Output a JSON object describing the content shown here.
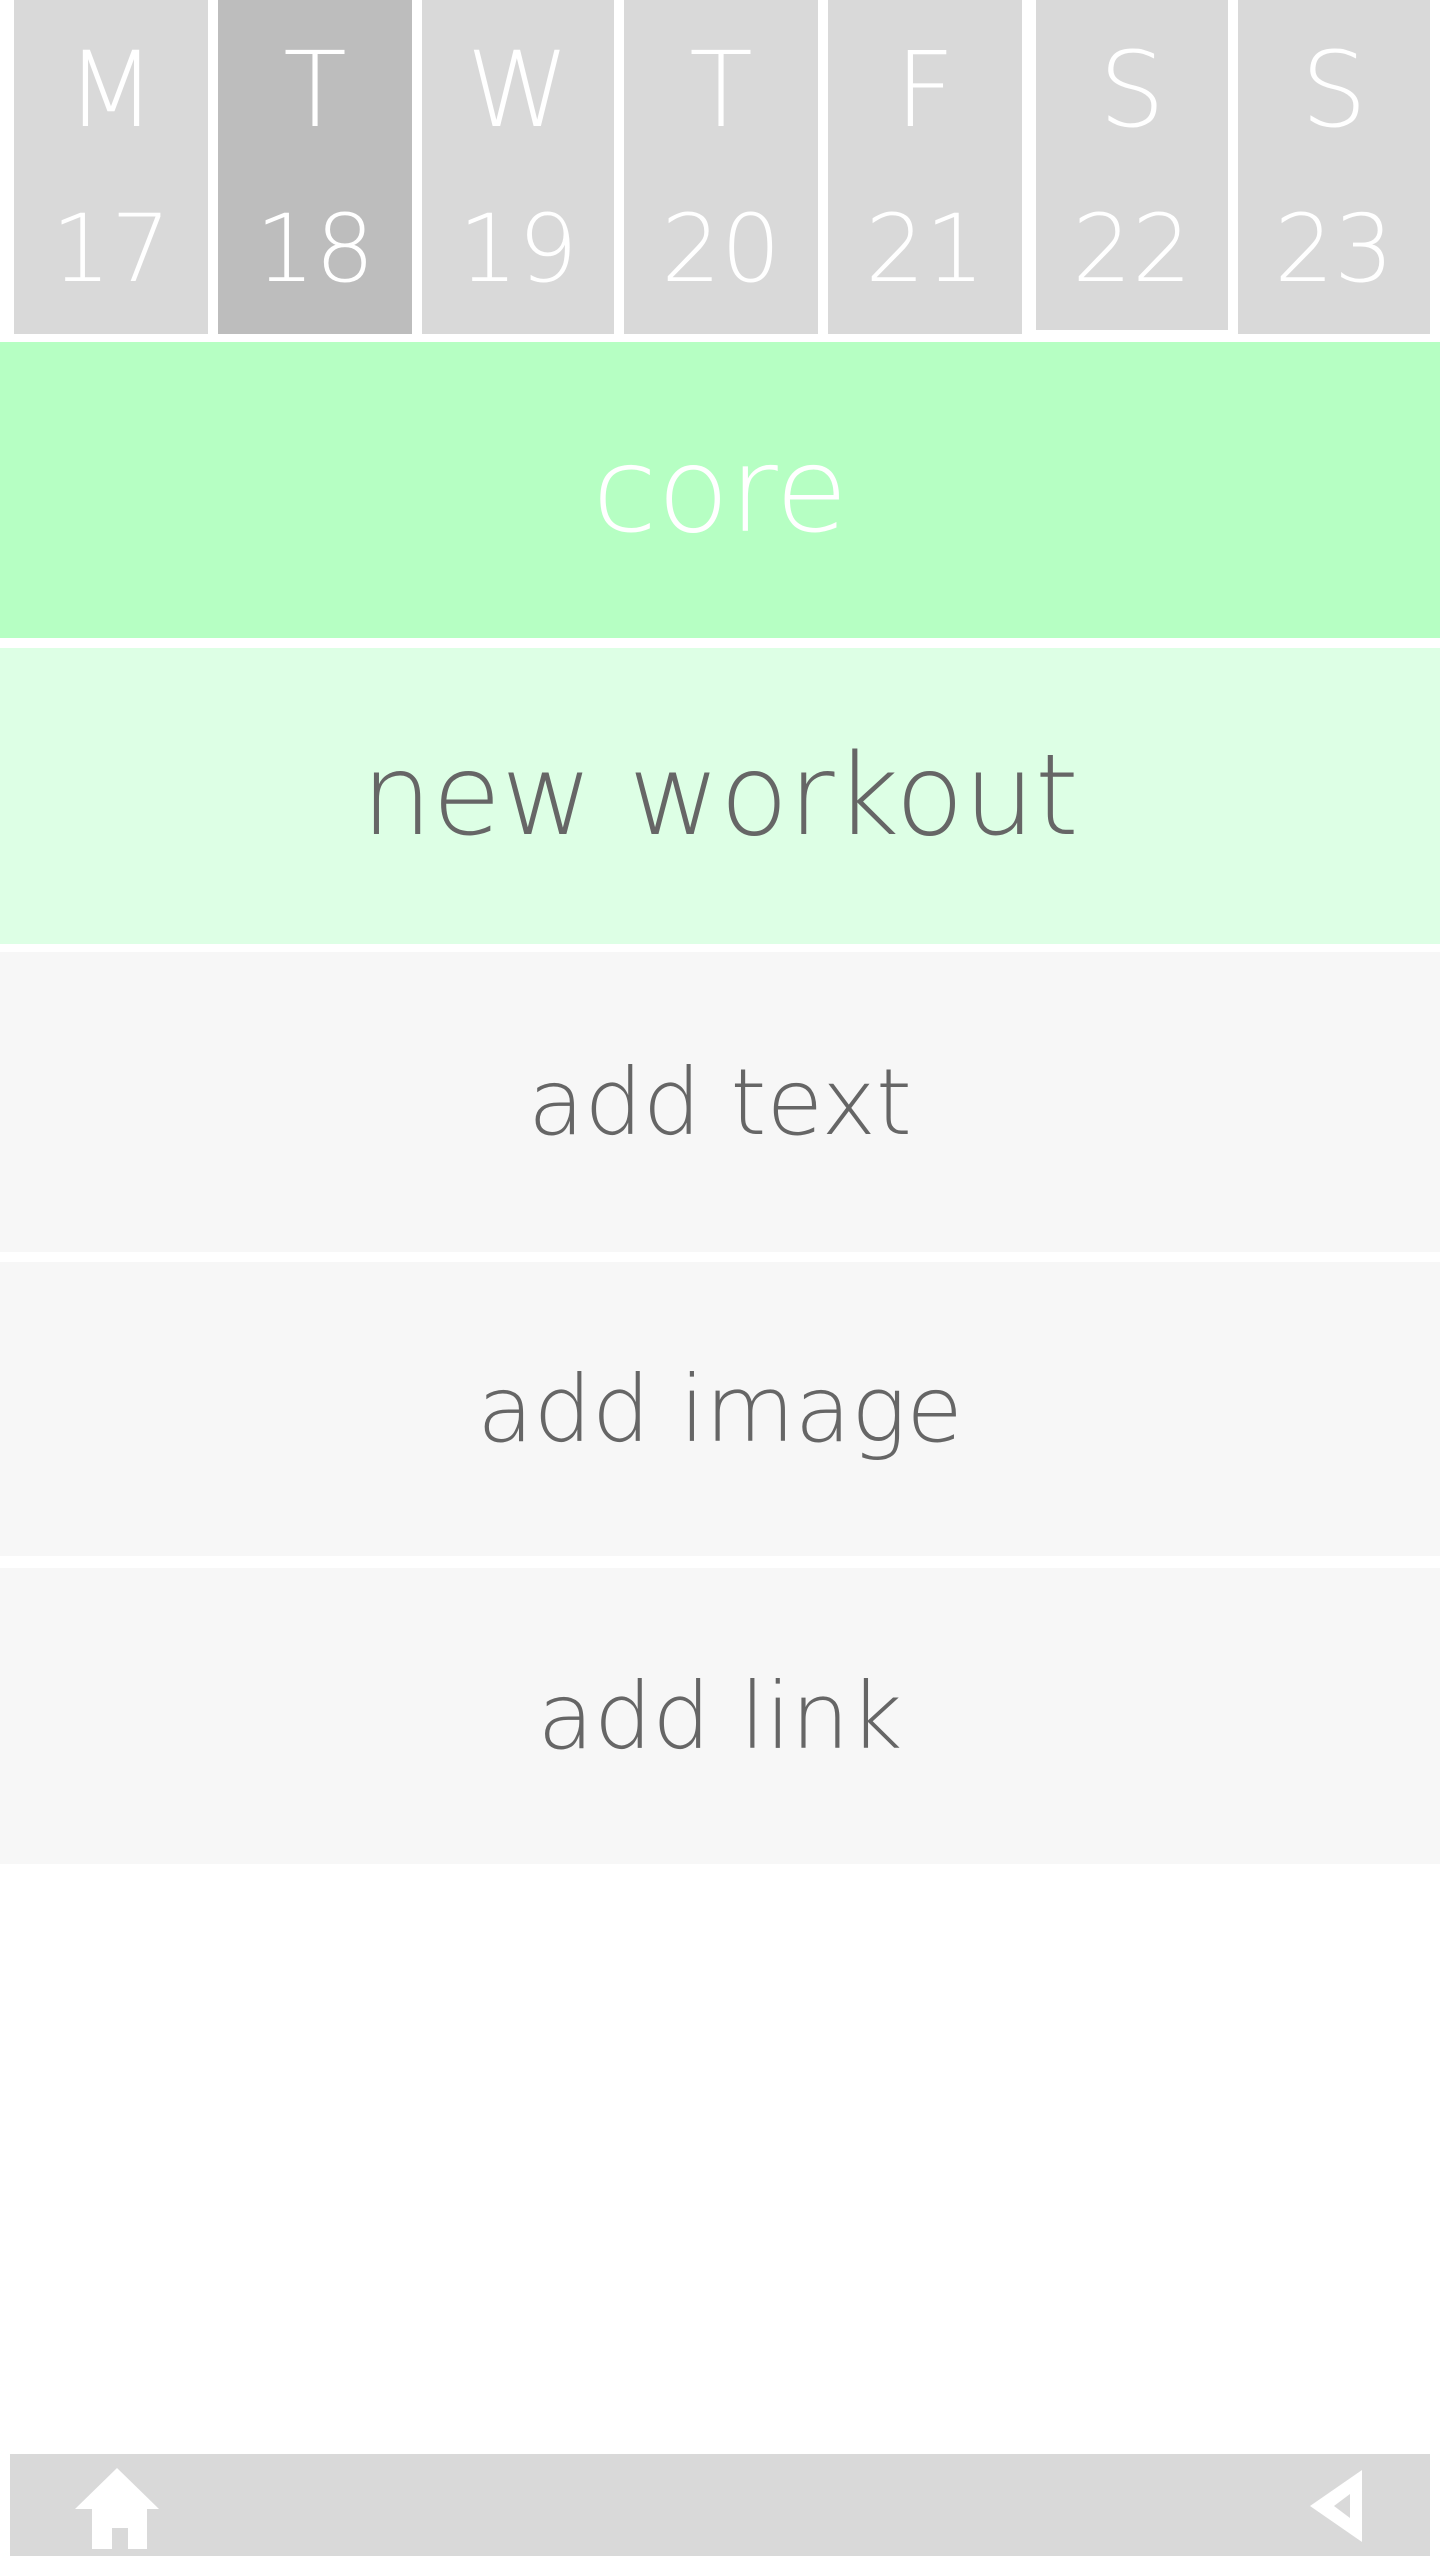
{
  "week": {
    "days": [
      {
        "letter": "M",
        "number": "17"
      },
      {
        "letter": "T",
        "number": "18",
        "selected": true
      },
      {
        "letter": "W",
        "number": "19"
      },
      {
        "letter": "T",
        "number": "20"
      },
      {
        "letter": "F",
        "number": "21"
      },
      {
        "letter": "S",
        "number": "22"
      },
      {
        "letter": "S",
        "number": "23"
      }
    ]
  },
  "rows": {
    "core": "core",
    "new_workout": "new workout",
    "add_text": "add text",
    "add_image": "add image",
    "add_link": "add link"
  },
  "bottom_bar": {
    "home_icon": "home-icon",
    "back_icon": "back-triangle-icon"
  },
  "colors": {
    "day_bg": "#d9d9d9",
    "day_selected_bg": "#bdbdbd",
    "core_bg": "#b6ffc3",
    "new_workout_bg": "#ddffe5",
    "action_bg": "#f7f7f7",
    "text_dark": "#666666",
    "text_light": "#ffffff"
  }
}
